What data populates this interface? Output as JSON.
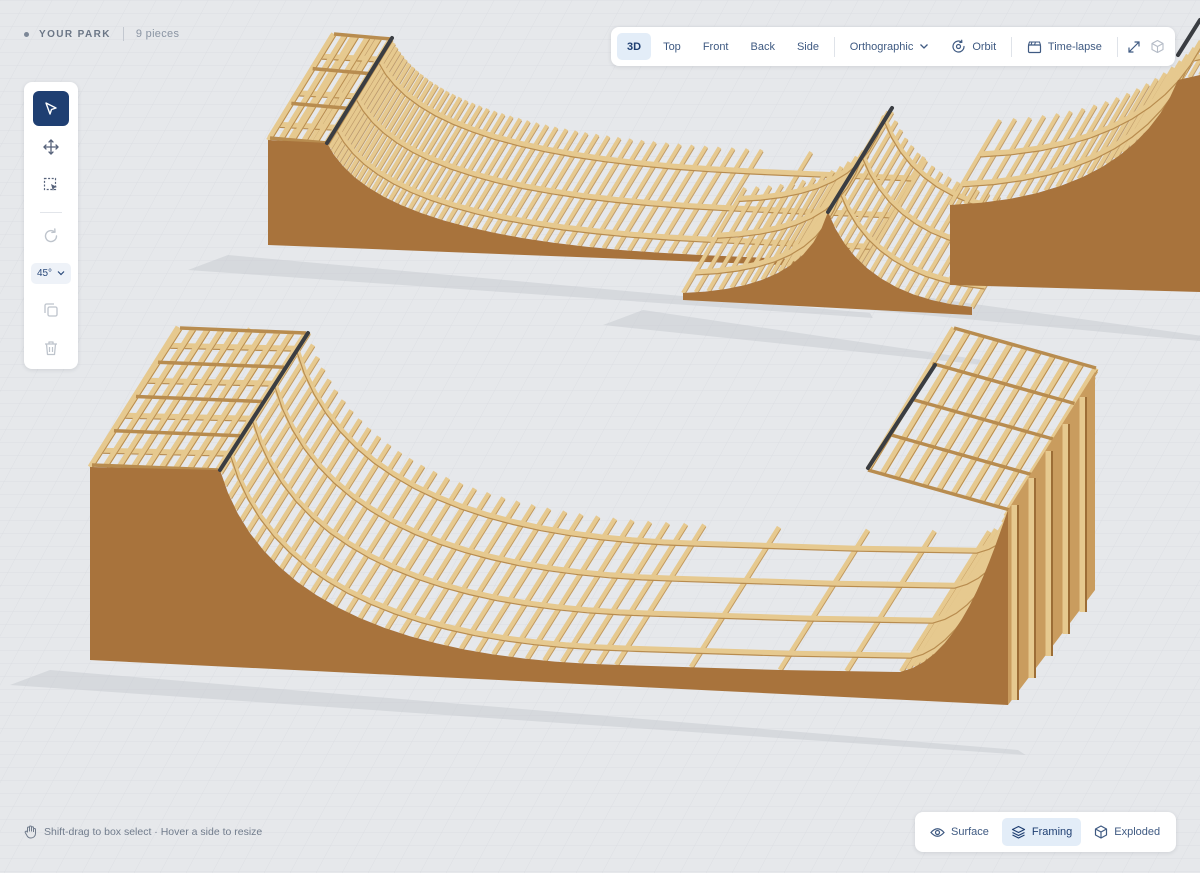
{
  "park": {
    "name": "YOUR PARK",
    "piece_count": "9 pieces"
  },
  "tools": {
    "angle": "45°",
    "items": [
      {
        "name": "select",
        "icon": "cursor-arrow-icon",
        "active": true
      },
      {
        "name": "move",
        "icon": "move-arrows-icon"
      },
      {
        "name": "box-select",
        "icon": "box-select-icon"
      },
      {
        "name": "rotate",
        "icon": "rotate-icon"
      },
      {
        "name": "duplicate",
        "icon": "duplicate-icon"
      },
      {
        "name": "delete",
        "icon": "trash-icon"
      }
    ]
  },
  "toolbar": {
    "views": [
      "3D",
      "Top",
      "Front",
      "Back",
      "Side"
    ],
    "active_view": "3D",
    "projection": "Orthographic",
    "orbit_label": "Orbit",
    "timelapse_label": "Time-lapse",
    "icons": [
      "chevron-down-icon",
      "orbit-icon",
      "clapperboard-icon",
      "expand-icon",
      "cube-icon"
    ]
  },
  "hint": {
    "text": "Shift-drag to box select · Hover a side to resize",
    "icon": "hand-icon"
  },
  "view_modes": {
    "items": [
      "Surface",
      "Framing",
      "Exploded"
    ],
    "active": "Framing",
    "icons": [
      "eye-icon",
      "layers-icon",
      "box-icon"
    ]
  },
  "colors": {
    "background": "#e6e8eb",
    "accent": "#1f3f72",
    "accent_light": "#e3edf8",
    "plywood_side": "#a8733c",
    "lumber": "#e6c98f",
    "lumber_edge": "#b88c4f",
    "coping": "#3a3d42"
  }
}
